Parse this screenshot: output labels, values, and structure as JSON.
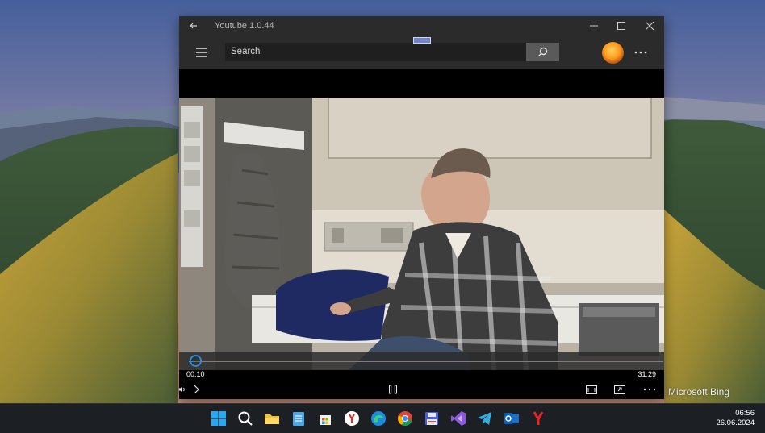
{
  "window": {
    "title": "Youtube 1.0.44"
  },
  "header": {
    "search_placeholder": "Search"
  },
  "player": {
    "current_time": "00:10",
    "total_time": "31:29",
    "progress_fraction": 0.0053
  },
  "desktop": {
    "watermark": "Microsoft Bing"
  },
  "taskbar": {
    "time": "06:56",
    "date": "26.06.2024",
    "icons": [
      "windows-start-icon",
      "search-icon",
      "file-explorer-icon",
      "notepad-icon",
      "microsoft-store-icon",
      "yandex-browser-icon",
      "edge-icon",
      "chrome-icon",
      "save-disk-icon",
      "visual-studio-icon",
      "telegram-icon",
      "outlook-icon",
      "yandex-icon"
    ]
  },
  "colors": {
    "accent": "#2f8ad8",
    "titlebar": "#2b2b2b",
    "taskbar": "#1c1f24"
  }
}
